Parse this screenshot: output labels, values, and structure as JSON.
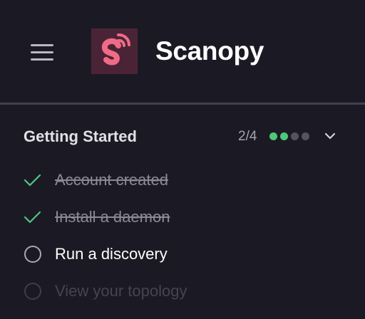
{
  "header": {
    "app_name": "Scanopy",
    "menu_icon": "hamburger-menu-icon",
    "logo_icon": "scanopy-logo-icon"
  },
  "colors": {
    "background": "#1b1a24",
    "logo_bg": "#4a2436",
    "logo_fg": "#f06b86",
    "check": "#4ec77a",
    "dot_done": "#4ec77a",
    "dot_todo": "#55545e",
    "text_primary": "#ffffff",
    "text_done": "#8b8a94",
    "text_pending": "#45444f"
  },
  "getting_started": {
    "title": "Getting Started",
    "progress": "2/4",
    "completed_steps": 2,
    "total_steps": 4,
    "collapse_icon": "chevron-down-icon",
    "tasks": [
      {
        "label": "Account created",
        "status": "done",
        "icon": "check-icon"
      },
      {
        "label": "Install a daemon",
        "status": "done",
        "icon": "check-icon"
      },
      {
        "label": "Run a discovery",
        "status": "active",
        "icon": "circle-icon"
      },
      {
        "label": "View your topology",
        "status": "pending",
        "icon": "circle-icon"
      }
    ]
  }
}
